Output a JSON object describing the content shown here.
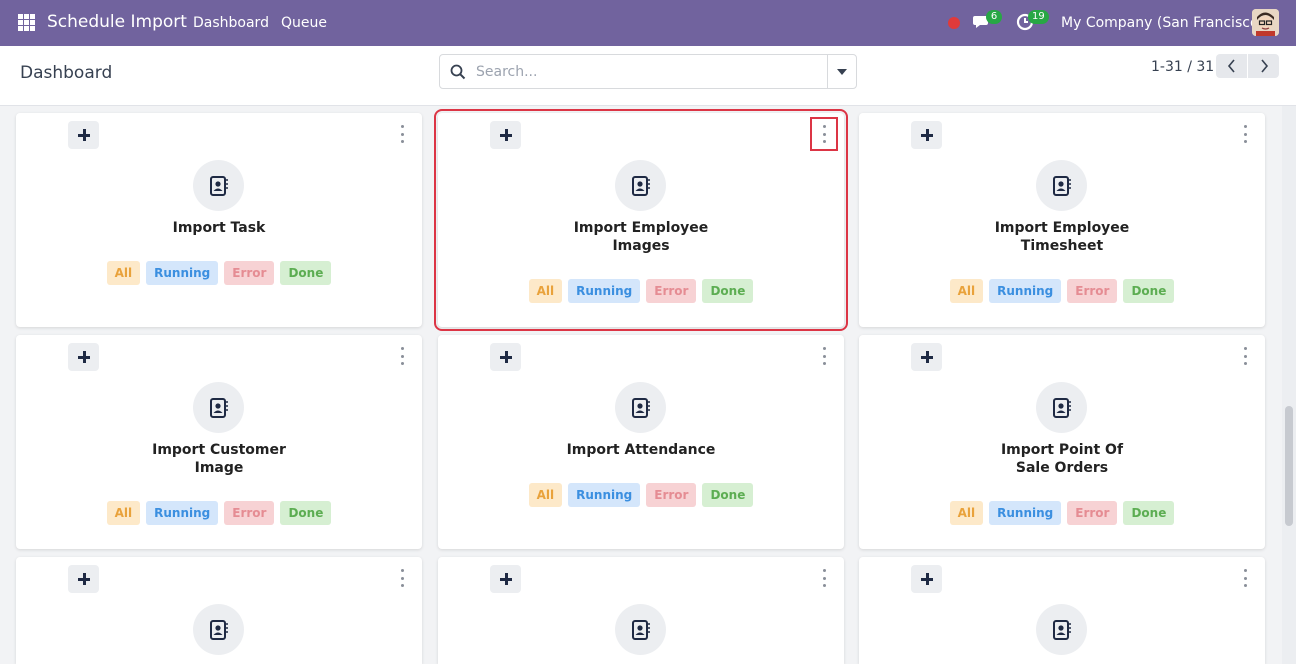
{
  "navbar": {
    "app_title": "Schedule Import",
    "menu": [
      "Dashboard",
      "Queue"
    ],
    "messages_count": "6",
    "activities_count": "19",
    "company": "My Company (San Francisco)"
  },
  "control_panel": {
    "title": "Dashboard",
    "search_placeholder": "Search...",
    "pager": "1-31 / 31"
  },
  "state_labels": {
    "all": "All",
    "running": "Running",
    "error": "Error",
    "done": "Done"
  },
  "cards": [
    {
      "title": "Import Task"
    },
    {
      "title": "Import Employee Images"
    },
    {
      "title": "Import Employee Timesheet"
    },
    {
      "title": "Import Customer Image"
    },
    {
      "title": "Import Attendance"
    },
    {
      "title": "Import Point Of Sale Orders"
    },
    {
      "title": ""
    },
    {
      "title": ""
    },
    {
      "title": ""
    }
  ],
  "icons": {
    "apps": "apps-grid-icon",
    "chat": "chat-icon",
    "activity": "clock-icon",
    "card": "address-book-icon",
    "add": "plus-icon",
    "menu": "kebab-menu-icon"
  },
  "colors": {
    "navbar": "#71639e",
    "selection_outline": "#dc3545"
  }
}
